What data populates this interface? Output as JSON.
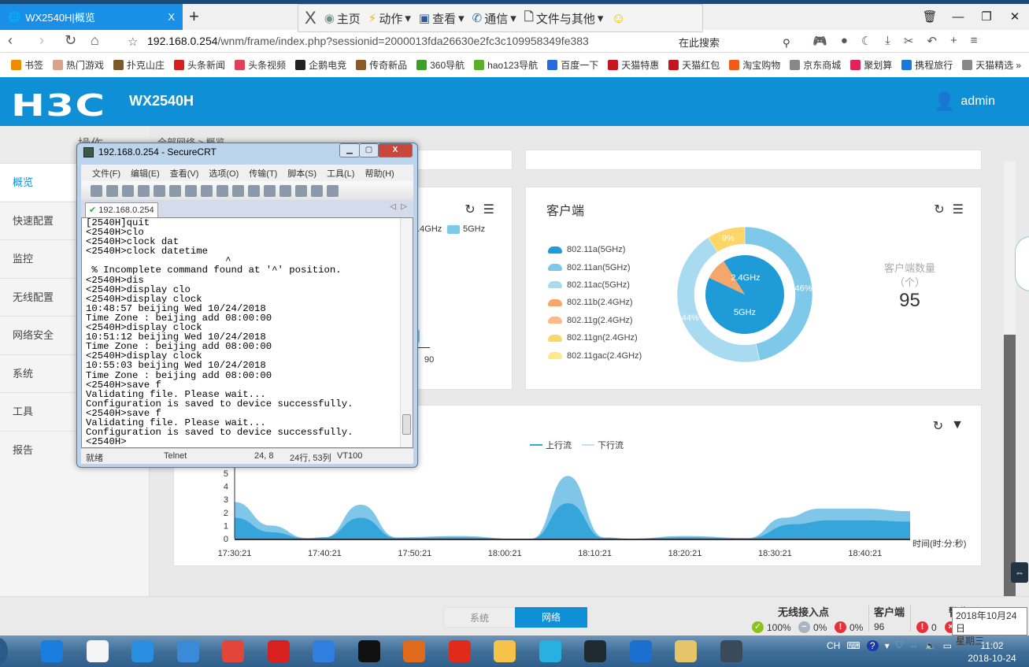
{
  "browser": {
    "tab_title": "WX2540H|概览",
    "tab_close": "X",
    "new_tab": "+",
    "url_host": "192.168.0.254",
    "url_path": "/wnm/frame/index.php?sessionid=2000013fda26630e2fc3c109958349fe383",
    "search_placeholder": "在此搜索",
    "window_buttons": [
      "🗑",
      "—",
      "❐",
      "✕"
    ],
    "toolbar_icons": [
      "game-icon",
      "extension-icon",
      "night-mode-icon",
      "download-icon",
      "scissors-icon",
      "undo-icon",
      "add-icon",
      "menu-icon"
    ],
    "bookmarks": [
      {
        "label": "书签",
        "color": "#f08a00"
      },
      {
        "label": "热门游戏",
        "color": "#d9a38a"
      },
      {
        "label": "扑克山庄",
        "color": "#7a5a2a"
      },
      {
        "label": "头条新闻",
        "color": "#d6201f"
      },
      {
        "label": "头条视频",
        "color": "#e0405a"
      },
      {
        "label": "企鹅电竞",
        "color": "#222"
      },
      {
        "label": "传奇新品",
        "color": "#8a5a2a"
      },
      {
        "label": "360导航",
        "color": "#3aa02a"
      },
      {
        "label": "hao123导航",
        "color": "#5ab02a"
      },
      {
        "label": "百度一下",
        "color": "#2a6adf"
      },
      {
        "label": "天猫特惠",
        "color": "#c8141e"
      },
      {
        "label": "天猫红包",
        "color": "#c8141e"
      },
      {
        "label": "淘宝购物",
        "color": "#f25a1a"
      },
      {
        "label": "京东商城",
        "color": "#888"
      },
      {
        "label": "聚划算",
        "color": "#e0245a"
      },
      {
        "label": "携程旅行",
        "color": "#1a78d8"
      },
      {
        "label": "天猫精选",
        "color": "#888"
      }
    ],
    "more": "»"
  },
  "remote_toolbar": {
    "items": [
      "主页",
      "动作",
      "查看",
      "通信",
      "文件与其他"
    ],
    "close": "X"
  },
  "header": {
    "logo": "H3C",
    "model": "WX2540H",
    "user": "admin"
  },
  "sidebar": {
    "title": "操作",
    "items": [
      "概览",
      "快速配置",
      "监控",
      "无线配置",
      "网络安全",
      "系统",
      "工具",
      "报告"
    ]
  },
  "breadcrumb": "全部网络 > 概览",
  "ap_panel": {
    "legend": [
      "2.4GHz",
      "5GHz"
    ],
    "axis_label": "90"
  },
  "clients_panel": {
    "title": "客户端",
    "legend": [
      {
        "label": "802.11a(5GHz)",
        "color": "#1f9bd7"
      },
      {
        "label": "802.11an(5GHz)",
        "color": "#7ec8ea"
      },
      {
        "label": "802.11ac(5GHz)",
        "color": "#a8daf0"
      },
      {
        "label": "802.11b(2.4GHz)",
        "color": "#f5a76b"
      },
      {
        "label": "802.11g(2.4GHz)",
        "color": "#fcb98a"
      },
      {
        "label": "802.11gn(2.4GHz)",
        "color": "#fdd66a"
      },
      {
        "label": "802.11gac(2.4GHz)",
        "color": "#fde98a"
      }
    ],
    "count_label": "客户端数量",
    "count_unit": "（个）",
    "count": "95"
  },
  "chart_data": [
    {
      "type": "pie",
      "title": "客户端",
      "inner": [
        {
          "name": "5GHz",
          "value": 91,
          "color": "#1f9bd7"
        },
        {
          "name": "2.4GHz",
          "value": 9,
          "color": "#f5a76b"
        }
      ],
      "outer": [
        {
          "name": "802.11an(5GHz)",
          "value": 46,
          "label": "46%",
          "color": "#7ec8ea"
        },
        {
          "name": "802.11ac(5GHz)",
          "value": 44,
          "label": "44%",
          "color": "#a8daf0"
        },
        {
          "name": "802.11gn(2.4GHz)",
          "value": 9,
          "label": "9%",
          "color": "#fdd66a"
        }
      ]
    },
    {
      "type": "area",
      "title": "",
      "xlabel": "时间(时:分:秒)",
      "ylabel": "",
      "ylim": [
        0,
        5
      ],
      "yticks": [
        "0",
        "1",
        "2",
        "3",
        "4",
        "5"
      ],
      "xticks": [
        "17:30:21",
        "17:40:21",
        "17:50:21",
        "18:00:21",
        "18:10:21",
        "18:20:21",
        "18:30:21",
        "18:40:21"
      ],
      "x_minutes_range": [
        0,
        75
      ],
      "series": [
        {
          "name": "下行流",
          "color": "#7fc6e8",
          "points": [
            [
              0,
              2.8
            ],
            [
              4,
              1.0
            ],
            [
              8,
              0.05
            ],
            [
              10,
              0.1
            ],
            [
              14,
              2.6
            ],
            [
              18,
              0.1
            ],
            [
              25,
              0.2
            ],
            [
              31,
              0
            ],
            [
              33,
              0
            ],
            [
              37,
              4.8
            ],
            [
              41,
              0.1
            ],
            [
              44,
              0
            ],
            [
              50,
              0.2
            ],
            [
              57,
              0.05
            ],
            [
              61,
              1.6
            ],
            [
              65,
              2.3
            ],
            [
              70,
              2.3
            ],
            [
              75,
              2.1
            ]
          ]
        },
        {
          "name": "上行流",
          "color": "#36a6da",
          "points": [
            [
              0,
              1.6
            ],
            [
              4,
              0.5
            ],
            [
              8,
              0.02
            ],
            [
              10,
              0.1
            ],
            [
              14,
              1.6
            ],
            [
              18,
              0.05
            ],
            [
              25,
              0.1
            ],
            [
              31,
              0
            ],
            [
              33,
              0
            ],
            [
              37,
              2.7
            ],
            [
              41,
              0.05
            ],
            [
              44,
              0
            ],
            [
              50,
              0.1
            ],
            [
              57,
              0.02
            ],
            [
              62,
              1.1
            ],
            [
              66,
              1.4
            ],
            [
              70,
              1.4
            ],
            [
              75,
              1.3
            ]
          ]
        }
      ],
      "legend": [
        "上行流",
        "下行流"
      ],
      "legend_position": "top-center"
    }
  ],
  "bottom": {
    "tabs": [
      "系统",
      "网络"
    ],
    "ap_label": "无线接入点",
    "ap_online": "100%",
    "ap_idle": "0%",
    "ap_fault": "0%",
    "client_label": "客户端",
    "client_count": "96",
    "alarm_label": "警告",
    "alarm_count": "0"
  },
  "tooltip": {
    "date": "2018年10月24日",
    "weekday": "星期三"
  },
  "taskbar": {
    "apps": [
      "kugou-icon",
      "file-icon",
      "ie-icon",
      "browser-icon",
      "chrome-icon",
      "maiche-icon",
      "feiyu-icon",
      "qq-icon",
      "pdf-icon",
      "netease-music-icon",
      "kuaikan-icon",
      "video-icon",
      "nox-icon",
      "teamviewer-icon",
      "folder-icon",
      "securecrt-icon"
    ],
    "app_colors": [
      "#1a7ee0",
      "#f5f5f5",
      "#2a8fe0",
      "#3a8ad8",
      "#e2463a",
      "#d8201f",
      "#2f7ee0",
      "#111",
      "#e06a1a",
      "#e02a1a",
      "#f6c24a",
      "#27b0e0",
      "#1f2a30",
      "#1a6fd0",
      "#e5c46a",
      "#3a4a5a"
    ],
    "lang": "CH",
    "time": "11:02",
    "date": "2018-10-24"
  },
  "securecrt": {
    "title": "192.168.0.254 - SecureCRT",
    "menu": [
      "文件(F)",
      "编辑(E)",
      "查看(V)",
      "选项(O)",
      "传输(T)",
      "脚本(S)",
      "工具(L)",
      "帮助(H)"
    ],
    "tab": "192.168.0.254",
    "lines": [
      "[2540H]quit",
      "<2540H>clo",
      "<2540H>clock dat",
      "<2540H>clock datetime",
      "                        ^",
      " % Incomplete command found at '^' position.",
      "<2540H>dis",
      "<2540H>display clo",
      "<2540H>display clock",
      "10:48:57 beijing Wed 10/24/2018",
      "Time Zone : beijing add 08:00:00",
      "<2540H>display clock",
      "10:51:12 beijing Wed 10/24/2018",
      "Time Zone : beijing add 08:00:00",
      "<2540H>display clock",
      "10:55:03 beijing Wed 10/24/2018",
      "Time Zone : beijing add 08:00:00",
      "<2540H>save f",
      "Validating file. Please wait...",
      "Configuration is saved to device successfully.",
      "<2540H>save f",
      "Validating file. Please wait...",
      "Configuration is saved to device successfully.",
      "<2540H>"
    ],
    "status": {
      "state": "就绪",
      "protocol": "Telnet",
      "cursor": "24,  8",
      "size": "24行, 53列",
      "emulation": "VT100"
    }
  }
}
